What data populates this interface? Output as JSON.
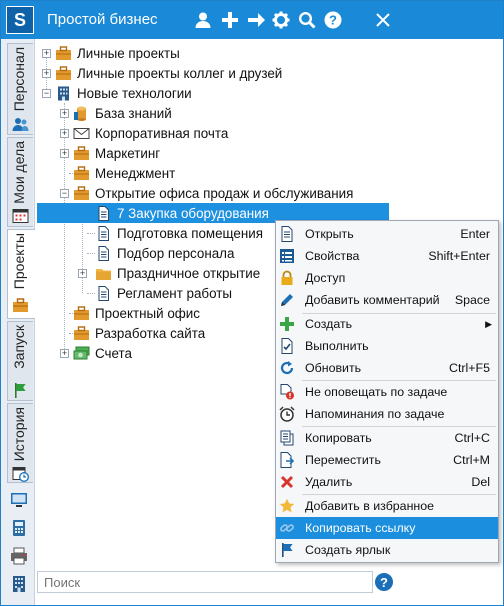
{
  "app": {
    "title": "Простой бизнес",
    "logo_letter": "S"
  },
  "titlebar_icons": [
    "user-icon",
    "plus-icon",
    "arrow-right-icon",
    "gear-icon",
    "search-icon",
    "help-icon",
    "close-icon"
  ],
  "side_tabs": [
    {
      "label": "Персонал",
      "icon": "people-icon"
    },
    {
      "label": "Мои дела",
      "icon": "calendar-icon"
    },
    {
      "label": "Проекты",
      "icon": "briefcase-icon"
    },
    {
      "label": "Запуск",
      "icon": "flag-icon"
    },
    {
      "label": "История",
      "icon": "calendar-clock-icon"
    }
  ],
  "tree": [
    {
      "label": "Личные проекты",
      "icon": "briefcase-icon",
      "level": 0,
      "expander": "+"
    },
    {
      "label": "Личные проекты коллег и друзей",
      "icon": "briefcase-icon",
      "level": 0,
      "expander": "+"
    },
    {
      "label": "Новые технологии",
      "icon": "building-icon",
      "level": 0,
      "expander": "-"
    },
    {
      "label": "База знаний",
      "icon": "database-icon",
      "level": 1,
      "expander": "+"
    },
    {
      "label": "Корпоративная почта",
      "icon": "mail-icon",
      "level": 1,
      "expander": "+"
    },
    {
      "label": "Маркетинг",
      "icon": "briefcase-icon",
      "level": 1,
      "expander": "+"
    },
    {
      "label": "Менеджмент",
      "icon": "briefcase-icon",
      "level": 1,
      "expander": ""
    },
    {
      "label": "Открытие офиса продаж и обслуживания",
      "icon": "briefcase-icon",
      "level": 1,
      "expander": "-"
    },
    {
      "label": "7 Закупка оборудования",
      "icon": "document-icon",
      "level": 2,
      "expander": "",
      "selected": true
    },
    {
      "label": "Подготовка помещения",
      "icon": "document-icon",
      "level": 2,
      "expander": ""
    },
    {
      "label": "Подбор персонала",
      "icon": "document-icon",
      "level": 2,
      "expander": ""
    },
    {
      "label": "Праздничное открытие",
      "icon": "folder-icon",
      "level": 2,
      "expander": "+"
    },
    {
      "label": "Регламент работы",
      "icon": "document-icon",
      "level": 2,
      "expander": ""
    },
    {
      "label": "Проектный офис",
      "icon": "briefcase-icon",
      "level": 1,
      "expander": ""
    },
    {
      "label": "Разработка сайта",
      "icon": "briefcase-icon",
      "level": 1,
      "expander": ""
    },
    {
      "label": "Счета",
      "icon": "money-icon",
      "level": 1,
      "expander": "+"
    }
  ],
  "search": {
    "placeholder": "Поиск"
  },
  "context_menu": [
    {
      "label": "Открыть",
      "shortcut": "Enter",
      "icon": "document-icon"
    },
    {
      "label": "Свойства",
      "shortcut": "Shift+Enter",
      "icon": "properties-icon"
    },
    {
      "label": "Доступ",
      "shortcut": "",
      "icon": "lock-icon"
    },
    {
      "label": "Добавить комментарий",
      "shortcut": "Space",
      "icon": "pencil-icon",
      "sep_after": true
    },
    {
      "label": "Создать",
      "shortcut": "",
      "icon": "plus-icon",
      "submenu": true
    },
    {
      "label": "Выполнить",
      "shortcut": "",
      "icon": "check-document-icon"
    },
    {
      "label": "Обновить",
      "shortcut": "Ctrl+F5",
      "icon": "refresh-icon",
      "sep_after": true
    },
    {
      "label": "Не оповещать по задаче",
      "shortcut": "",
      "icon": "mute-notify-icon"
    },
    {
      "label": "Напоминания по задаче",
      "shortcut": "",
      "icon": "alarm-icon",
      "sep_after": true
    },
    {
      "label": "Копировать",
      "shortcut": "Ctrl+C",
      "icon": "copy-icon"
    },
    {
      "label": "Переместить",
      "shortcut": "Ctrl+M",
      "icon": "move-icon"
    },
    {
      "label": "Удалить",
      "shortcut": "Del",
      "icon": "delete-icon",
      "sep_after": true
    },
    {
      "label": "Добавить в избранное",
      "shortcut": "",
      "icon": "star-icon"
    },
    {
      "label": "Копировать ссылку",
      "shortcut": "",
      "icon": "link-icon",
      "highlighted": true
    },
    {
      "label": "Создать ярлык",
      "shortcut": "",
      "icon": "flag-icon"
    }
  ],
  "colors": {
    "accent": "#1a8ad8",
    "selection": "#1e90e0",
    "menu_highlight": "#1b8fdd"
  }
}
